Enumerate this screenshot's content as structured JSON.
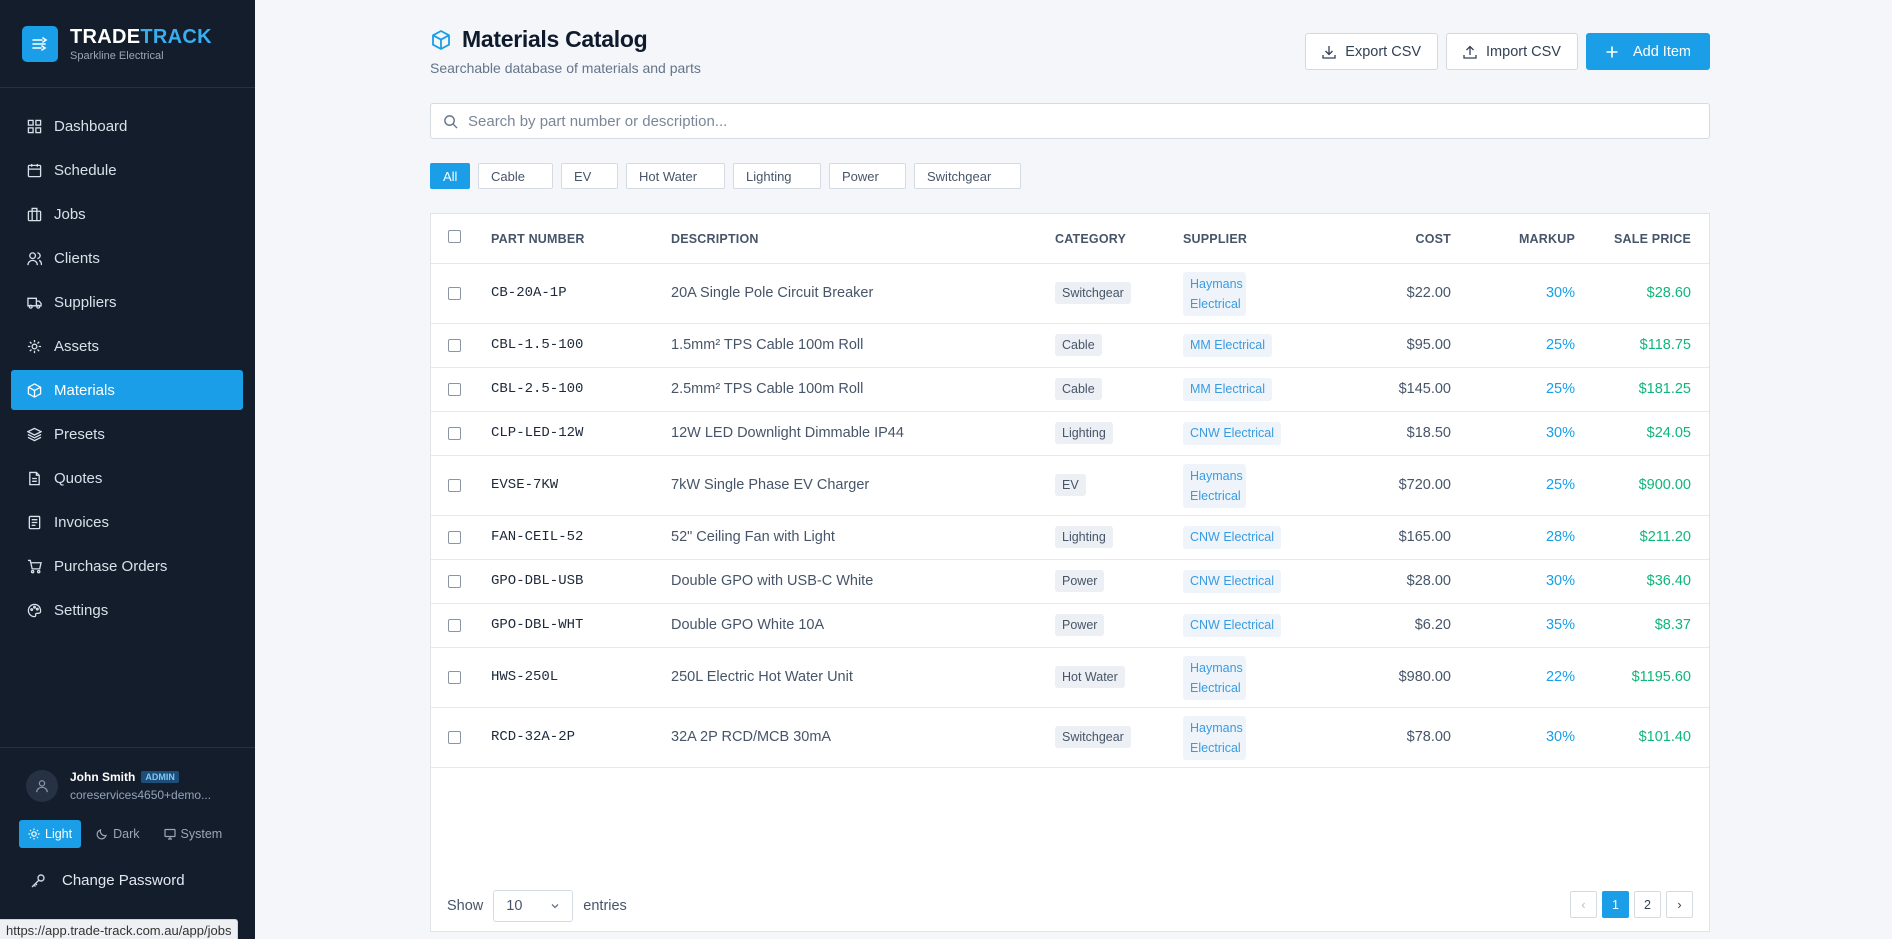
{
  "brand": {
    "name_a": "TRADE",
    "name_b": "TRACK",
    "sub": "Sparkline Electrical"
  },
  "nav": [
    {
      "label": "Dashboard",
      "icon": "dashboard-icon"
    },
    {
      "label": "Schedule",
      "icon": "calendar-icon"
    },
    {
      "label": "Jobs",
      "icon": "briefcase-icon"
    },
    {
      "label": "Clients",
      "icon": "users-icon"
    },
    {
      "label": "Suppliers",
      "icon": "truck-icon"
    },
    {
      "label": "Assets",
      "icon": "gear-icon"
    },
    {
      "label": "Materials",
      "icon": "box-icon",
      "active": true
    },
    {
      "label": "Presets",
      "icon": "layers-icon"
    },
    {
      "label": "Quotes",
      "icon": "document-icon"
    },
    {
      "label": "Invoices",
      "icon": "receipt-icon"
    },
    {
      "label": "Purchase Orders",
      "icon": "cart-icon"
    },
    {
      "label": "Settings",
      "icon": "palette-icon"
    }
  ],
  "user": {
    "name": "John Smith",
    "role": "ADMIN",
    "email": "coreservices4650+demo..."
  },
  "theme": {
    "light": "Light",
    "dark": "Dark",
    "system": "System"
  },
  "change_password": "Change Password",
  "status_url": "https://app.trade-track.com.au/app/jobs",
  "page": {
    "title": "Materials Catalog",
    "subtitle": "Searchable database of materials and parts",
    "export_label": "Export CSV",
    "import_label": "Import CSV",
    "add_label": "Add Item",
    "search_placeholder": "Search by part number or description..."
  },
  "filters": [
    "All",
    "Cable",
    "EV",
    "Hot Water",
    "Lighting",
    "Power",
    "Switchgear"
  ],
  "columns": {
    "part": "PART NUMBER",
    "desc": "DESCRIPTION",
    "cat": "CATEGORY",
    "sup": "SUPPLIER",
    "cost": "COST",
    "markup": "MARKUP",
    "sale": "SALE PRICE"
  },
  "rows": [
    {
      "part": "CB-20A-1P",
      "desc": "20A Single Pole Circuit Breaker",
      "cat": "Switchgear",
      "sup": "Haymans Electrical",
      "cost": "$22.00",
      "markup": "30%",
      "sale": "$28.60"
    },
    {
      "part": "CBL-1.5-100",
      "desc": "1.5mm² TPS Cable 100m Roll",
      "cat": "Cable",
      "sup": "MM Electrical",
      "cost": "$95.00",
      "markup": "25%",
      "sale": "$118.75"
    },
    {
      "part": "CBL-2.5-100",
      "desc": "2.5mm² TPS Cable 100m Roll",
      "cat": "Cable",
      "sup": "MM Electrical",
      "cost": "$145.00",
      "markup": "25%",
      "sale": "$181.25"
    },
    {
      "part": "CLP-LED-12W",
      "desc": "12W LED Downlight Dimmable IP44",
      "cat": "Lighting",
      "sup": "CNW Electrical",
      "cost": "$18.50",
      "markup": "30%",
      "sale": "$24.05"
    },
    {
      "part": "EVSE-7KW",
      "desc": "7kW Single Phase EV Charger",
      "cat": "EV",
      "sup": "Haymans Electrical",
      "cost": "$720.00",
      "markup": "25%",
      "sale": "$900.00"
    },
    {
      "part": "FAN-CEIL-52",
      "desc": "52\" Ceiling Fan with Light",
      "cat": "Lighting",
      "sup": "CNW Electrical",
      "cost": "$165.00",
      "markup": "28%",
      "sale": "$211.20"
    },
    {
      "part": "GPO-DBL-USB",
      "desc": "Double GPO with USB-C White",
      "cat": "Power",
      "sup": "CNW Electrical",
      "cost": "$28.00",
      "markup": "30%",
      "sale": "$36.40"
    },
    {
      "part": "GPO-DBL-WHT",
      "desc": "Double GPO White 10A",
      "cat": "Power",
      "sup": "CNW Electrical",
      "cost": "$6.20",
      "markup": "35%",
      "sale": "$8.37"
    },
    {
      "part": "HWS-250L",
      "desc": "250L Electric Hot Water Unit",
      "cat": "Hot Water",
      "sup": "Haymans Electrical",
      "cost": "$980.00",
      "markup": "22%",
      "sale": "$1195.60"
    },
    {
      "part": "RCD-32A-2P",
      "desc": "32A 2P RCD/MCB 30mA",
      "cat": "Switchgear",
      "sup": "Haymans Electrical",
      "cost": "$78.00",
      "markup": "30%",
      "sale": "$101.40"
    }
  ],
  "footer": {
    "show": "Show",
    "entries_value": "10",
    "entries": "entries",
    "pages": [
      "1",
      "2"
    ],
    "prev": "‹",
    "next": "›"
  },
  "colors": {
    "accent": "#1a9ee8",
    "sidebar": "#141d2b",
    "sale": "#10b57a"
  }
}
